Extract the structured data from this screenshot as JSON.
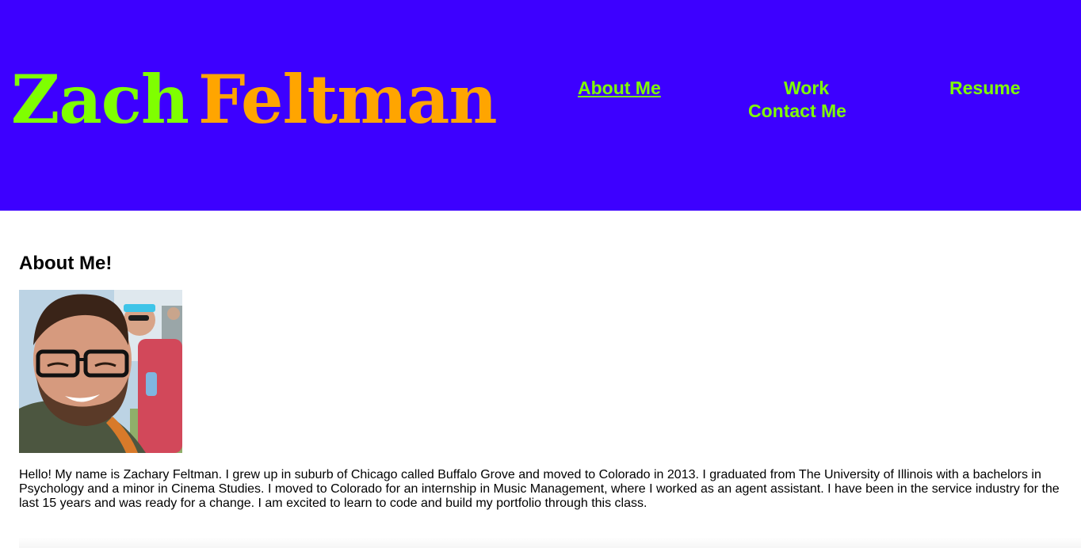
{
  "header": {
    "logo_first": "Zach",
    "logo_last": "Feltman",
    "background_color": "#3d00ff",
    "logo_first_color": "#7fff00",
    "logo_last_color": "#ffa500"
  },
  "nav": {
    "items": [
      {
        "label": "About Me",
        "active": true
      },
      {
        "label": "Work",
        "active": false
      },
      {
        "label": "Resume",
        "active": false
      },
      {
        "label": "Contact Me",
        "active": false
      }
    ],
    "link_color": "#7fff00"
  },
  "main": {
    "title": "About Me!",
    "bio": "Hello! My name is Zachary Feltman. I grew up in suburb of Chicago called Buffalo Grove and moved to Colorado in 2013. I graduated from The University of Illinois with a bachelors in Psychology and a minor in Cinema Studies. I moved to Colorado for an internship in Music Management, where I worked as an agent assistant. I have been in the service industry for the last 15 years and was ready for a change. I am excited to learn to code and build my portfolio through this class."
  }
}
